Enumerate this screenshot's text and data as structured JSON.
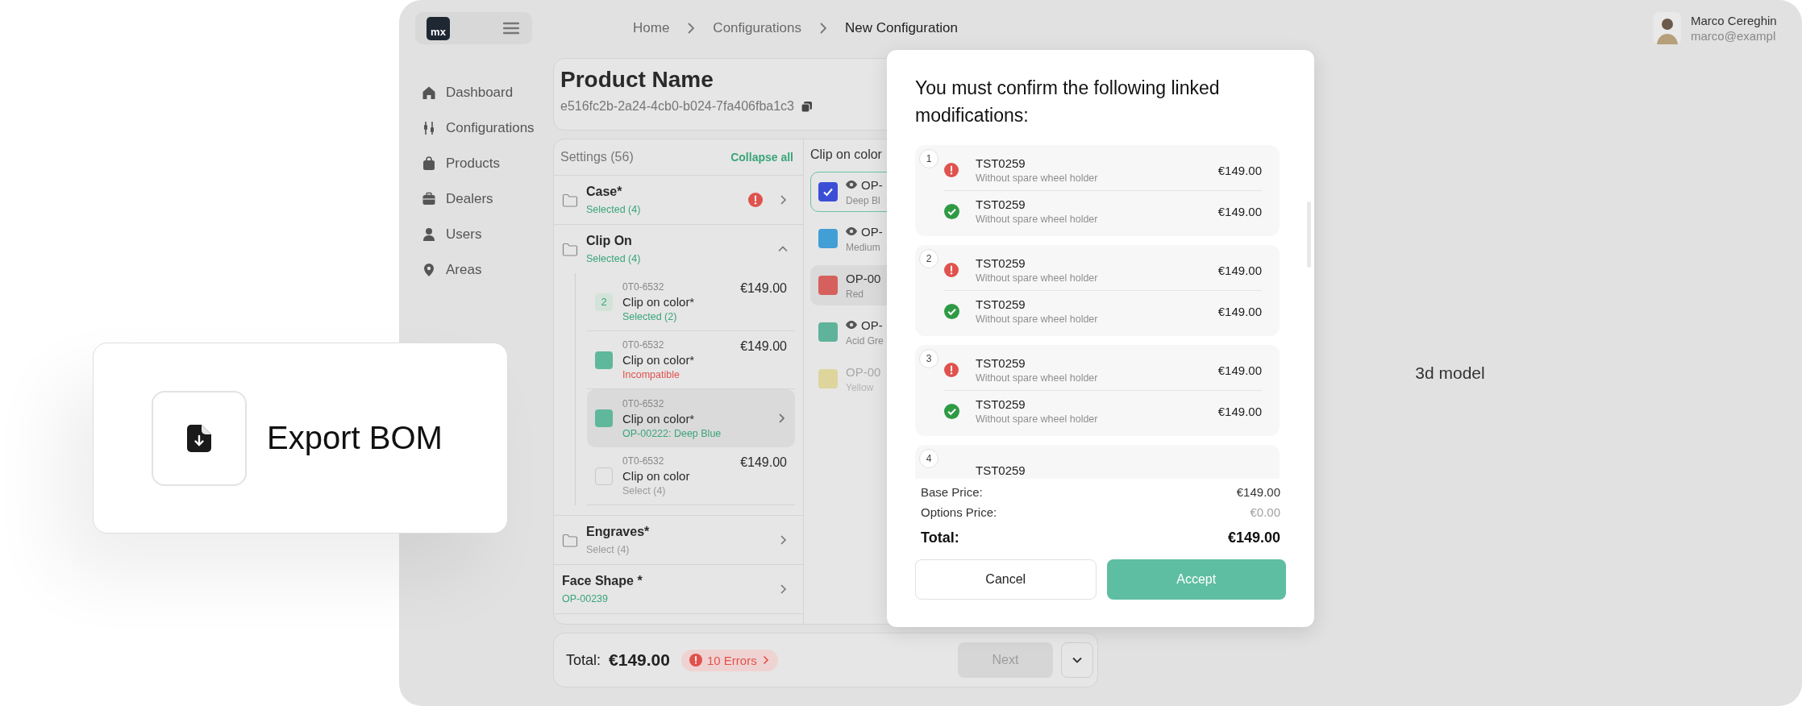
{
  "export_card": {
    "label": "Export BOM"
  },
  "logo": "mx",
  "breadcrumb": [
    {
      "label": "Home",
      "current": false
    },
    {
      "label": "Configurations",
      "current": false
    },
    {
      "label": "New Configuration",
      "current": true
    }
  ],
  "user": {
    "name": "Marco Cereghin",
    "email": "marco@exampl"
  },
  "sidebar": {
    "items": [
      {
        "label": "Dashboard"
      },
      {
        "label": "Configurations"
      },
      {
        "label": "Products"
      },
      {
        "label": "Dealers"
      },
      {
        "label": "Users"
      },
      {
        "label": "Areas"
      }
    ]
  },
  "product": {
    "name": "Product Name",
    "id": "e516fc2b-2a24-4cb0-b024-7fa406fba1c3"
  },
  "settings": {
    "title": "Settings (56)",
    "collapse_label": "Collapse all",
    "groups": [
      {
        "name": "Case*",
        "status": {
          "text": "Selected (4)",
          "color": "#3aa57a"
        },
        "folder": true,
        "error": true,
        "expanded": false
      },
      {
        "name": "Clip On",
        "status": {
          "text": "Selected (4)",
          "color": "#3aa57a"
        },
        "folder": true,
        "error": false,
        "expanded": true,
        "children": [
          {
            "kind": "count",
            "badge": "2",
            "code": "0T0-6532",
            "price": "€149.00",
            "name": "Clip on color*",
            "status": {
              "text": "Selected (2)",
              "color": "#3aa57a"
            },
            "highlighted": false
          },
          {
            "kind": "swatch",
            "color": "#5fb89c",
            "code": "0T0-6532",
            "price": "€149.00",
            "name": "Clip on color*",
            "status": {
              "text": "Incompatible",
              "color": "#e0524d"
            },
            "highlighted": false
          },
          {
            "kind": "swatch",
            "color": "#5fb89c",
            "code": "0T0-6532",
            "name": "Clip on color*",
            "status": {
              "text": "OP-00222: Deep Blue",
              "color": "#3aa57a"
            },
            "highlighted": true
          },
          {
            "kind": "empty",
            "code": "0T0-6532",
            "price": "€149.00",
            "name": "Clip on color",
            "status": {
              "text": "Select (4)",
              "color": "#9a9a9a"
            },
            "highlighted": false
          }
        ]
      },
      {
        "name": "Engraves*",
        "status": {
          "text": "Select (4)",
          "color": "#9a9a9a"
        },
        "folder": true,
        "error": false,
        "expanded": false
      },
      {
        "name": "Face Shape *",
        "status": {
          "text": "OP-00239",
          "color": "#3aa57a"
        },
        "folder": false,
        "error": false,
        "expanded": false
      }
    ]
  },
  "options_panel": {
    "title": "Clip on color",
    "options": [
      {
        "code": "OP-",
        "name": "Deep Bl",
        "color": "#3b4fd6",
        "selected": true,
        "visibility_icon": true,
        "highlighted": false,
        "disabled": false
      },
      {
        "code": "OP-",
        "name": "Medium",
        "color": "#429fd6",
        "selected": false,
        "visibility_icon": true,
        "highlighted": false,
        "disabled": false
      },
      {
        "code": "OP-00",
        "name": "Red",
        "color": "#d6605c",
        "selected": false,
        "visibility_icon": false,
        "highlighted": true,
        "disabled": false
      },
      {
        "code": "OP-",
        "name": "Acid Gre",
        "color": "#5fb39a",
        "selected": false,
        "visibility_icon": true,
        "highlighted": false,
        "disabled": false
      },
      {
        "code": "OP-00",
        "name": "Yellow",
        "color": "#ddd59c",
        "selected": false,
        "visibility_icon": false,
        "highlighted": false,
        "disabled": true
      }
    ]
  },
  "footer": {
    "total_label": "Total:",
    "total": "€149.00",
    "errors": "10 Errors",
    "next": "Next",
    "next_disabled": true
  },
  "model_view": {
    "label": "3d model"
  },
  "modal": {
    "title": "You must confirm the following linked modifications:",
    "groups": [
      {
        "number": "1",
        "items": [
          {
            "kind": "error",
            "code": "TST0259",
            "description": "Without spare wheel holder",
            "price": "€149.00"
          },
          {
            "kind": "ok",
            "code": "TST0259",
            "description": "Without spare wheel holder",
            "price": "€149.00"
          }
        ]
      },
      {
        "number": "2",
        "items": [
          {
            "kind": "error",
            "code": "TST0259",
            "description": "Without spare wheel holder",
            "price": "€149.00"
          },
          {
            "kind": "ok",
            "code": "TST0259",
            "description": "Without spare wheel holder",
            "price": "€149.00"
          }
        ]
      },
      {
        "number": "3",
        "items": [
          {
            "kind": "error",
            "code": "TST0259",
            "description": "Without spare wheel holder",
            "price": "€149.00"
          },
          {
            "kind": "ok",
            "code": "TST0259",
            "description": "Without spare wheel holder",
            "price": "€149.00"
          }
        ]
      },
      {
        "number": "4",
        "items": [
          {
            "code": "TST0259"
          }
        ]
      }
    ],
    "summary": [
      {
        "label": "Base Price:",
        "value": "€149.00",
        "kind": "normal"
      },
      {
        "label": "Options Price:",
        "value": "€0.00",
        "kind": "muted"
      },
      {
        "label": "Total:",
        "value": "€149.00",
        "kind": "total"
      }
    ],
    "buttons": [
      {
        "label": "Cancel",
        "kind": "secondary"
      },
      {
        "label": "Accept",
        "kind": "primary"
      }
    ]
  }
}
